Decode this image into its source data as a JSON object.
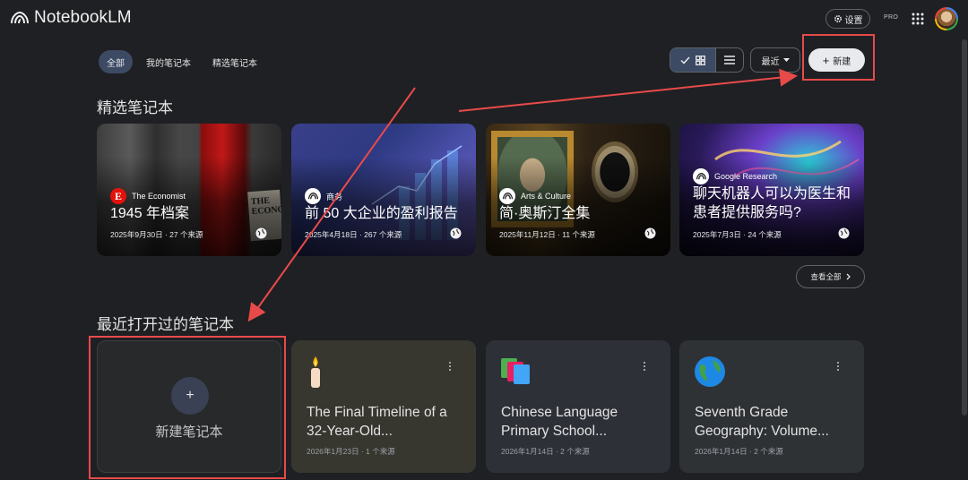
{
  "app": {
    "title": "NotebookLM"
  },
  "header": {
    "settings_label": "设置",
    "pro_label": "PRO"
  },
  "filters": {
    "all": "全部",
    "mine": "我的笔记本",
    "featured": "精选笔记本"
  },
  "toolbar": {
    "sort_label": "最近",
    "new_label": "新建"
  },
  "featured": {
    "title": "精选笔记本",
    "view_all": "查看全部",
    "cards": [
      {
        "source": "The Economist",
        "title": "1945 年档案",
        "meta": "2025年9月30日 · 27 个来源"
      },
      {
        "source": "商务",
        "title": "前 50 大企业的盈利报告",
        "meta": "2025年4月18日 · 267 个来源"
      },
      {
        "source": "Arts & Culture",
        "title": "简·奥斯汀全集",
        "meta": "2025年11月12日 · 11 个来源"
      },
      {
        "source": "Google Research",
        "title": "聊天机器人可以为医生和患者提供服务吗?",
        "meta": "2025年7月3日 · 24 个来源"
      }
    ]
  },
  "recent": {
    "title": "最近打开过的笔记本",
    "new_notebook_label": "新建笔记本",
    "cards": [
      {
        "icon": "candle-icon",
        "title": "The Final Timeline of a 32-Year-Old...",
        "meta": "2026年1月23日 · 1 个来源"
      },
      {
        "icon": "books-icon",
        "title": "Chinese Language Primary School...",
        "meta": "2026年1月14日 · 2 个来源"
      },
      {
        "icon": "earth-globe-icon",
        "title": "Seventh Grade Geography: Volume...",
        "meta": "2026年1月14日 · 2 个来源"
      }
    ]
  },
  "colors": {
    "background": "#1f2023",
    "card": "#2d2e31",
    "active_chip": "#3c4a63",
    "annotation": "#e84a4a"
  }
}
